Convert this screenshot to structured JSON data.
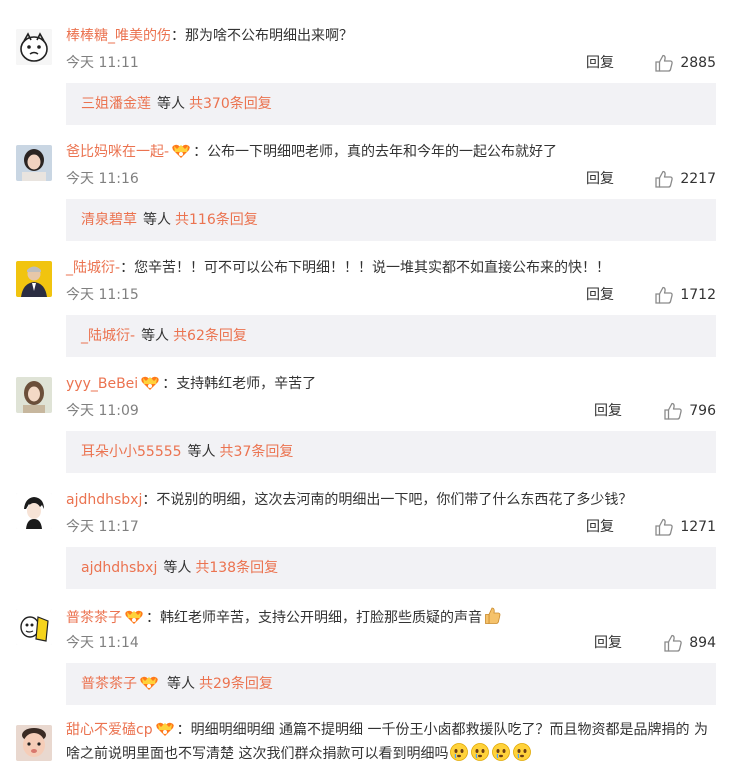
{
  "ui": {
    "reply_label": "回复",
    "others_label": "等人"
  },
  "comments": [
    {
      "username": "棒棒糖_唯美的伤",
      "vip": false,
      "text": "那为啥不公布明细出来啊？",
      "time": "今天 11:11",
      "likes": "2885",
      "sub_user": "三姐潘金莲",
      "sub_total": "共370条回复",
      "avatar_icon": "cartoon-face-avatar"
    },
    {
      "username": "爸比妈咪在一起-",
      "vip": true,
      "text": "公布一下明细吧老师，真的去年和今年的一起公布就好了",
      "time": "今天 11:16",
      "likes": "2217",
      "sub_user": "清泉碧草",
      "sub_total": "共116条回复",
      "avatar_icon": "girl-photo-avatar"
    },
    {
      "username": "_陆城衍-",
      "vip": false,
      "text": "您辛苦！！可不可以公布下明细！！！说一堆其实都不如直接公布来的快！！",
      "time": "今天 11:15",
      "likes": "1712",
      "sub_user": "_陆城衍-",
      "sub_total": "共62条回复",
      "avatar_icon": "man-in-suit-avatar"
    },
    {
      "username": "yyy_BeBei",
      "vip": true,
      "text": "支持韩红老师，辛苦了",
      "time": "今天 11:09",
      "likes": "796",
      "sub_user": "耳朵小小55555",
      "sub_total": "共37条回复",
      "avatar_icon": "girl-portrait-avatar"
    },
    {
      "username": "ajdhdhsbxj",
      "vip": false,
      "text": "不说别的明细，这次去河南的明细出一下吧，你们带了什么东西花了多少钱？",
      "time": "今天 11:17",
      "likes": "1271",
      "sub_user": "ajdhdhsbxj",
      "sub_total": "共138条回复",
      "avatar_icon": "anime-boy-avatar"
    },
    {
      "username": "普茶茶子",
      "vip": true,
      "text": "韩红老师辛苦，支持公开明细，打脸那些质疑的声音",
      "time": "今天 11:14",
      "likes": "894",
      "sub_user": "普茶茶子",
      "sub_total": "共29条回复",
      "avatar_icon": "cartoon-yellow-avatar"
    }
  ],
  "last_comment": {
    "username": "甜心不爱磕cp",
    "vip": true,
    "text": "明细明细明细 通篇不提明细 一千份王小卤都救援队吃了？而且物资都是品牌捐的 为啥之前说明里面也不写清楚 这次我们群众捐款可以看到明细吗",
    "avatar_icon": "baby-photo-avatar"
  },
  "colors": {
    "link": "#eb7350",
    "sub_bg": "#f2f2f5",
    "time": "#808080"
  }
}
